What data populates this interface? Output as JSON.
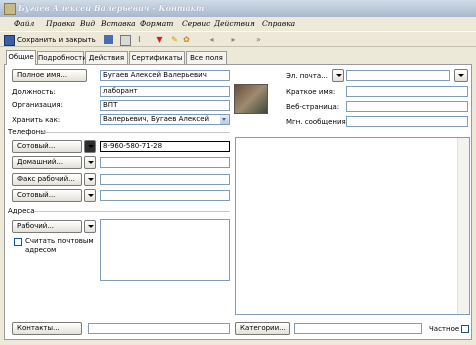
{
  "window": {
    "title": "Бугаев Алексей Валерьевич - Контакт"
  },
  "menu": [
    "Файл",
    "Правка",
    "Вид",
    "Вставка",
    "Формат",
    "Сервис",
    "Действия",
    "Справка"
  ],
  "toolbar": {
    "save_close": "Сохранить и закрыть"
  },
  "tabs": [
    "Общие",
    "Подробности",
    "Действия",
    "Сертификаты",
    "Все поля"
  ],
  "form": {
    "fullname_btn": "Полное имя...",
    "fullname": "Бугаев Алексей Валерьевич",
    "position_label": "Должность:",
    "position": "лаборант",
    "org_label": "Организация:",
    "org": "ВПТ",
    "file_as_label": "Хранить как:",
    "file_as": "Валерьевич, Бугаев Алексей",
    "phones_label": "Телефоны",
    "phone1_btn": "Сотовый...",
    "phone1": "8-960-580-71-28",
    "phone2_btn": "Домашний...",
    "phone3_btn": "Факс рабочий...",
    "phone4_btn": "Сотовый...",
    "address_label": "Адреса",
    "address_btn": "Рабочий...",
    "mailing_label": "Считать почтовым адресом",
    "email_btn": "Эл. почта...",
    "shortname_label": "Краткое имя:",
    "webpage_label": "Веб-страница:",
    "im_label": "Мгн. сообщения:",
    "contacts_btn": "Контакты...",
    "categories_btn": "Категории...",
    "private_label": "Частное"
  },
  "icons": [
    "app-icon",
    "save-icon",
    "print-icon",
    "attach-icon",
    "flag-icon",
    "category-icon",
    "prev-icon",
    "next-icon",
    "address-book-icon"
  ]
}
